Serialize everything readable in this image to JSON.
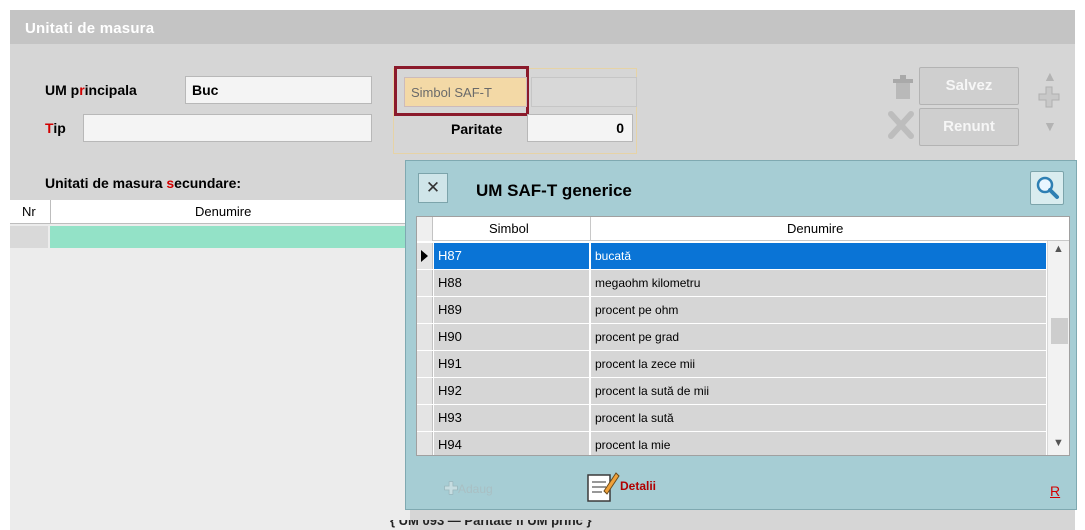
{
  "window": {
    "title": "Unitati de masura"
  },
  "form": {
    "um_principala_label_pre": "UM p",
    "um_principala_label_red": "r",
    "um_principala_label_post": "incipala",
    "um_principala_value": "Buc",
    "tip_label_red": "T",
    "tip_label_post": "ip",
    "tip_value": "",
    "saft_label": "Simbol SAF-T",
    "saft_value": "",
    "paritate_label": "Paritate",
    "paritate_value": "0"
  },
  "buttons": {
    "save": "Salvez",
    "cancel": "Renunt"
  },
  "secondary": {
    "title_pre": "Unitati de masura ",
    "title_red": "s",
    "title_post": "ecundare:",
    "columns": [
      "Nr",
      "Denumire"
    ]
  },
  "popup": {
    "title": "UM SAF-T generice",
    "columns": [
      "Simbol",
      "Denumire"
    ],
    "rows": [
      {
        "simbol": "H87",
        "denumire": "bucată",
        "selected": true
      },
      {
        "simbol": "H88",
        "denumire": "megaohm kilometru"
      },
      {
        "simbol": "H89",
        "denumire": "procent pe ohm"
      },
      {
        "simbol": "H90",
        "denumire": "procent pe grad"
      },
      {
        "simbol": "H91",
        "denumire": "procent la zece mii"
      },
      {
        "simbol": "H92",
        "denumire": "procent la sută de mii"
      },
      {
        "simbol": "H93",
        "denumire": "procent la sută"
      },
      {
        "simbol": "H94",
        "denumire": "procent la mie"
      }
    ],
    "footer": {
      "add": "Adaug",
      "details": "Detalii",
      "r": "R"
    }
  },
  "icons": [
    "close-icon",
    "search-icon",
    "plus-icon",
    "details-icon",
    "trash-icon",
    "cancel-x-icon",
    "arrow-up-icon",
    "arrow-down-icon",
    "row-pointer-icon"
  ],
  "colors": {
    "selected_row": "#0a74d6",
    "popup_bg": "#a6cdd4",
    "saft_highlight": "#8b1a2b",
    "new_row": "#93e2c7"
  }
}
